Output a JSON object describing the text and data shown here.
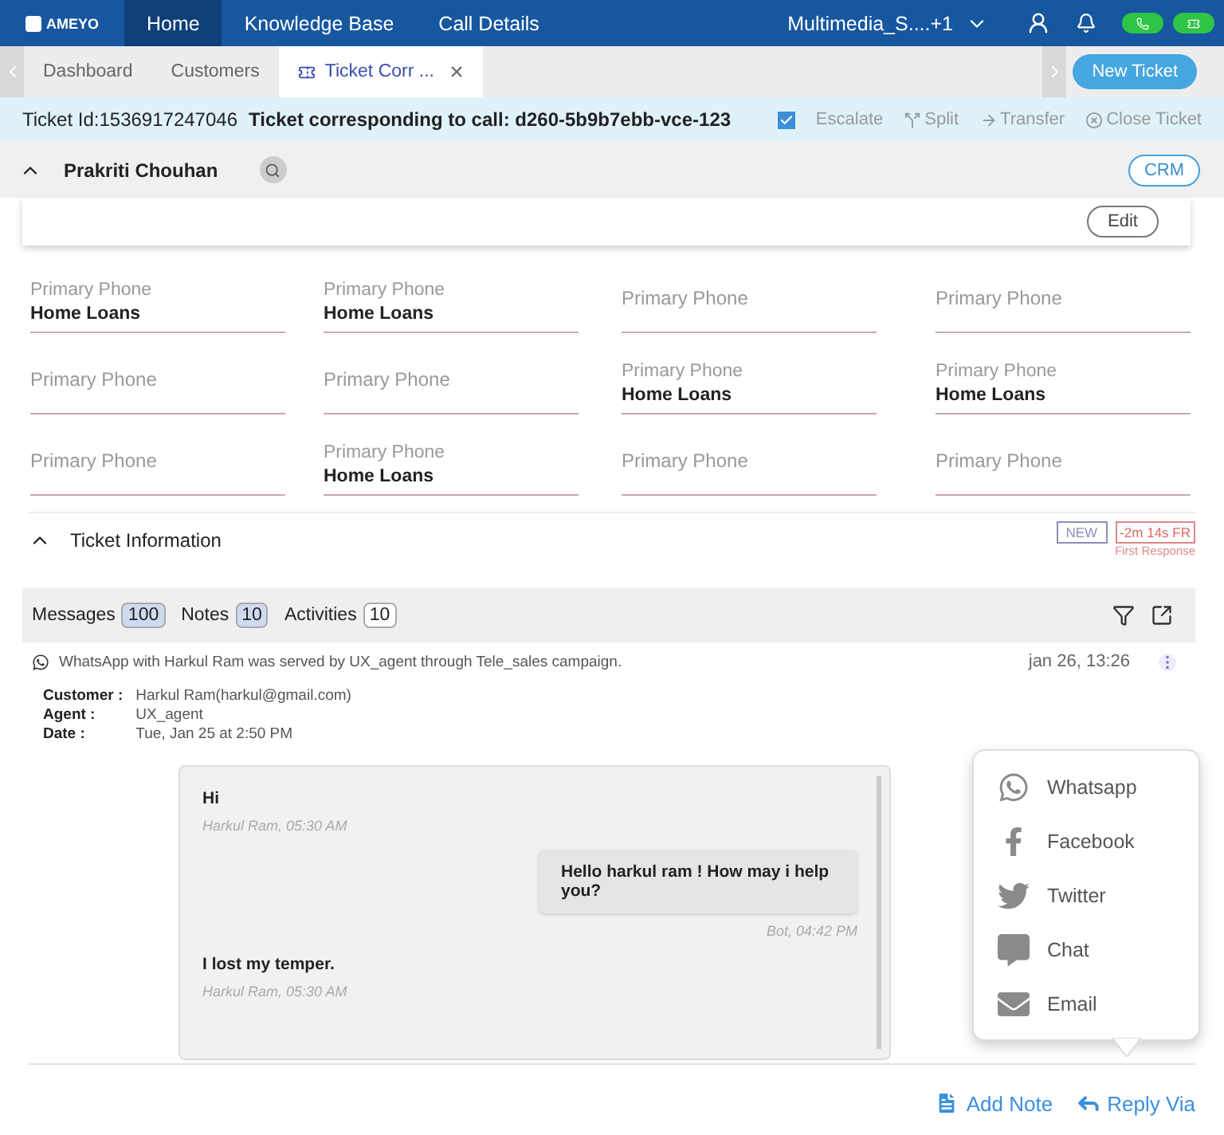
{
  "nav": {
    "logo": "AMEYO",
    "items": [
      {
        "label": "Home",
        "selected": true
      },
      {
        "label": "Knowledge Base",
        "selected": false
      },
      {
        "label": "Call Details",
        "selected": false
      }
    ],
    "queue": "Multimedia_S....+1"
  },
  "tabs": [
    {
      "label": "Dashboard",
      "selected": false
    },
    {
      "label": "Customers",
      "selected": false
    },
    {
      "label": "Ticket Corr ...",
      "selected": true,
      "close": "×"
    }
  ],
  "new_ticket": "New Ticket",
  "ticket": {
    "id": "Ticket Id:1536917247046",
    "title": "Ticket corresponding to call: d260-5b9b7ebb-vce-123",
    "escalate": {
      "label": "Escalate",
      "checked": true
    },
    "actions": [
      {
        "kind": "split",
        "label": "Split"
      },
      {
        "kind": "transfer",
        "label": "Transfer"
      },
      {
        "kind": "close",
        "label": "Close Ticket"
      }
    ]
  },
  "customer": {
    "name": "Prakriti Chouhan",
    "expanded": true,
    "crm": "CRM",
    "edit": "Edit"
  },
  "fields": [
    [
      {
        "label": "Primary Phone",
        "value": "Home Loans"
      },
      {
        "label": "Primary Phone",
        "value": "Home Loans"
      },
      {
        "label": "Primary Phone"
      },
      {
        "label": "Primary Phone"
      }
    ],
    [
      {
        "label": "Primary Phone"
      },
      {
        "label": "Primary Phone"
      },
      {
        "label": "Primary Phone",
        "value": "Home Loans"
      },
      {
        "label": "Primary Phone",
        "value": "Home Loans"
      }
    ],
    [
      {
        "label": "Primary Phone"
      },
      {
        "label": "Primary Phone",
        "value": "Home Loans"
      },
      {
        "label": "Primary Phone"
      },
      {
        "label": "Primary Phone"
      }
    ]
  ],
  "ticket_info": {
    "title": "Ticket Information",
    "expanded": true,
    "status": "NEW",
    "sla": "-2m 14s FR",
    "sla_caption": "First Response"
  },
  "message_tabs": [
    {
      "label": "Messages",
      "count": "100",
      "highlighted": true
    },
    {
      "label": "Notes",
      "count": "10",
      "highlighted": true
    },
    {
      "label": "Activities",
      "count": "10",
      "highlighted": false
    }
  ],
  "conversation": {
    "summary": "WhatsApp with Harkul Ram was served by UX_agent through Tele_sales campaign.",
    "time": "jan 26, 13:26",
    "details": [
      {
        "label": "Customer :",
        "value": "Harkul Ram(harkul@gmail.com)"
      },
      {
        "label": "Agent :",
        "value": "UX_agent"
      },
      {
        "label": "Date :",
        "value": "Tue, Jan 25 at 2:50 PM"
      }
    ],
    "messages": [
      {
        "kind": "incoming",
        "text": "Hi",
        "meta": "Harkul Ram, 05:30 AM"
      },
      {
        "kind": "outgoing",
        "text": "Hello harkul ram ! How may i help you?",
        "meta": "Bot, 04:42 PM"
      },
      {
        "kind": "incoming",
        "text": "I lost my temper.",
        "meta": "Harkul Ram, 05:30 AM"
      }
    ]
  },
  "reply_menu": [
    {
      "kind": "whatsapp",
      "label": "Whatsapp"
    },
    {
      "kind": "facebook",
      "label": "Facebook"
    },
    {
      "kind": "twitter",
      "label": "Twitter"
    },
    {
      "kind": "chat",
      "label": "Chat"
    },
    {
      "kind": "email",
      "label": "Email"
    }
  ],
  "footer": {
    "add_note": "Add Note",
    "reply_via": "Reply Via"
  }
}
